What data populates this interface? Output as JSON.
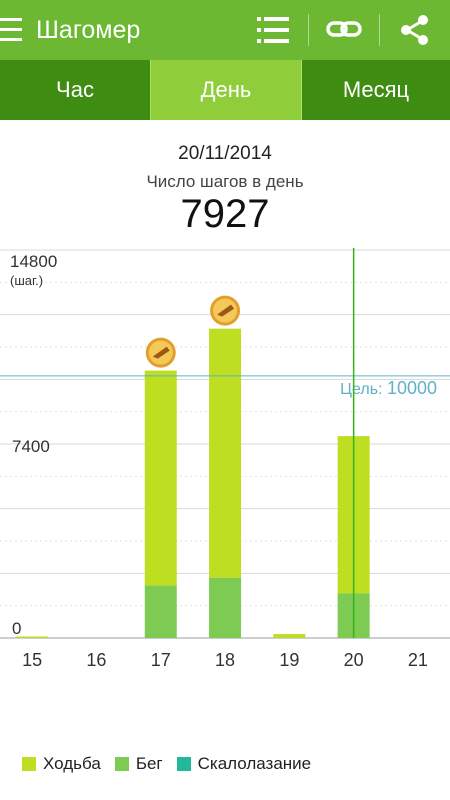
{
  "appbar": {
    "title": "Шагомер"
  },
  "tabs": [
    {
      "label": "Час",
      "active": false
    },
    {
      "label": "День",
      "active": true
    },
    {
      "label": "Месяц",
      "active": false
    }
  ],
  "summary": {
    "date": "20/11/2014",
    "subtitle": "Число шагов в день",
    "value": "7927"
  },
  "icons": {
    "menu": "hamburger-menu-icon",
    "list": "list-icon",
    "link": "link-icon",
    "share": "share-icon",
    "achievement": "shoe-medal-icon"
  },
  "colors": {
    "appbar": "#6cb833",
    "tabs": "#3f8c13",
    "active_tab": "#8fcd3a",
    "walking": "#bede22",
    "running": "#7dcb53",
    "climbing": "#24b89a",
    "goal_line": "#5fb2c8",
    "selection_line": "#37b219"
  },
  "chart_data": {
    "type": "bar",
    "stacked": true,
    "y_top_label": "14800",
    "y_unit_label": "(шаг.)",
    "y_mid_label": "7400",
    "y_zero_label": "0",
    "ylim": [
      0,
      14800
    ],
    "categories": [
      "15",
      "16",
      "17",
      "18",
      "19",
      "20",
      "21"
    ],
    "series": [
      {
        "name": "Ходьба",
        "values": [
          0,
          0,
          8200,
          9500,
          150,
          6000,
          0
        ]
      },
      {
        "name": "Бег",
        "values": [
          0,
          0,
          2000,
          2300,
          0,
          1700,
          0
        ]
      },
      {
        "name": "Скалолазание",
        "values": [
          0,
          0,
          0,
          0,
          0,
          0,
          0
        ]
      }
    ],
    "goal": {
      "label": "Цель:",
      "value": "10000",
      "y": 10000
    },
    "selected_category": "20",
    "achievement_days": [
      "17",
      "18"
    ],
    "grid": true,
    "legend_position": "bottom"
  }
}
